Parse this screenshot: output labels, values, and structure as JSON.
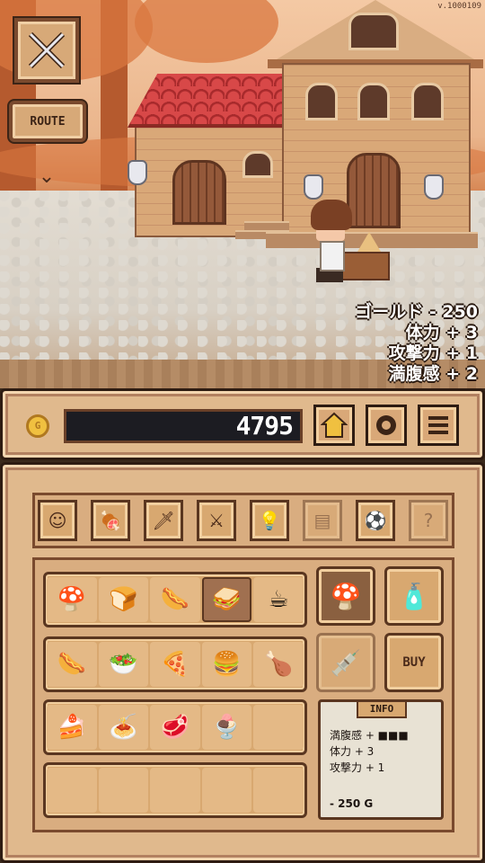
{
  "version": "v.1000109",
  "sidebar": {
    "route_label": "ROUTE"
  },
  "reward": {
    "gold": "ゴールド - 250",
    "stamina": "体力 + 3",
    "attack": "攻撃力 + 1",
    "fullness": "満腹感 + 2"
  },
  "hud": {
    "gold_amount": "4795",
    "coin_letter": "G"
  },
  "tabs": [
    {
      "icon": "character-icon"
    },
    {
      "icon": "meat-icon"
    },
    {
      "icon": "sword-icon"
    },
    {
      "icon": "crossed-swords-icon"
    },
    {
      "icon": "lightbulb-icon"
    },
    {
      "icon": "scroll-icon"
    },
    {
      "icon": "ball-icon"
    },
    {
      "icon": "question-icon"
    }
  ],
  "items": {
    "row1": [
      {
        "icon": "mushroom-icon",
        "glyph": "🍄"
      },
      {
        "icon": "bread-icon",
        "glyph": "🍞"
      },
      {
        "icon": "sausage-icon",
        "glyph": "🌭"
      },
      {
        "icon": "sandwich-icon",
        "glyph": "🥪"
      },
      {
        "icon": "coffee-icon",
        "glyph": "☕"
      }
    ],
    "row2": [
      {
        "icon": "hotdog-icon",
        "glyph": "🌭"
      },
      {
        "icon": "salad-icon",
        "glyph": "🥗"
      },
      {
        "icon": "pizza-icon",
        "glyph": "🍕"
      },
      {
        "icon": "burger-icon",
        "glyph": "🍔"
      },
      {
        "icon": "chicken-leg-icon",
        "glyph": "🍗"
      }
    ],
    "row3": [
      {
        "icon": "cake-icon",
        "glyph": "🍰"
      },
      {
        "icon": "pasta-icon",
        "glyph": "🍝"
      },
      {
        "icon": "steak-icon",
        "glyph": "🥩"
      },
      {
        "icon": "parfait-icon",
        "glyph": "🍨"
      },
      {
        "icon": "",
        "glyph": ""
      }
    ],
    "row4": [
      {
        "icon": "",
        "glyph": ""
      },
      {
        "icon": "",
        "glyph": ""
      },
      {
        "icon": "",
        "glyph": ""
      },
      {
        "icon": "",
        "glyph": ""
      },
      {
        "icon": "",
        "glyph": ""
      }
    ]
  },
  "side": {
    "buy_label": "BUY"
  },
  "info": {
    "title": "INFO",
    "fullness": "満腹感 + ■■■",
    "stamina": "体力 + 3",
    "attack": "攻撃力 + 1",
    "price": "- 250 G"
  },
  "colors": {
    "panel": "#e0b98d",
    "border": "#2e1c12",
    "reward_text": "#ffffff"
  }
}
